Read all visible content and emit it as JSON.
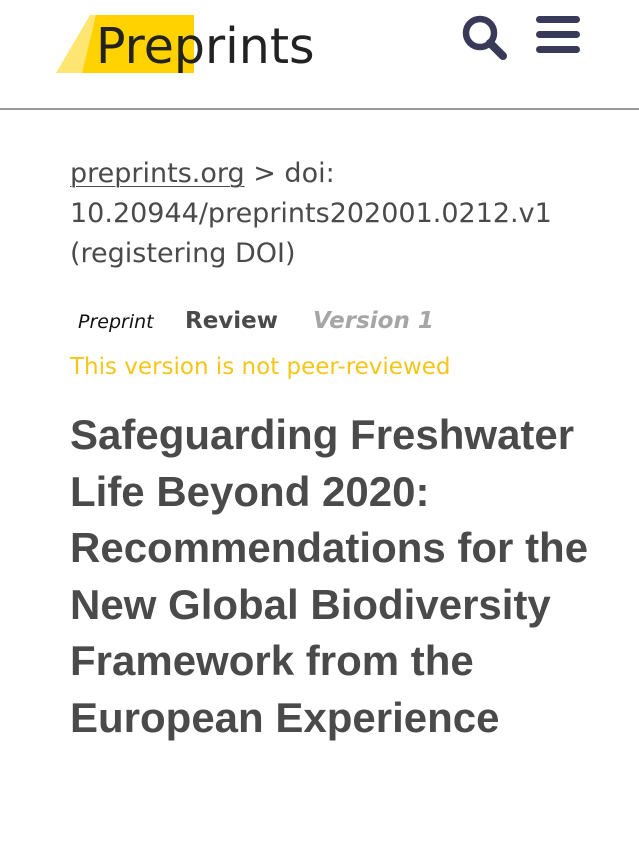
{
  "header": {
    "logo_text_prefix": "Pre",
    "logo_text_suffix": "prints",
    "brand_color": "#FFD200",
    "search_icon": "search-icon",
    "menu_icon": "hamburger-menu-icon"
  },
  "breadcrumb": {
    "site_link": "preprints.org",
    "separator": " > doi:",
    "doi": "10.20944/preprints202001.0212.v1",
    "status": "(registering DOI)"
  },
  "tabs": {
    "preprint": "Preprint",
    "review": "Review",
    "version": "Version 1"
  },
  "notice": {
    "text": "This version is not peer-reviewed",
    "color": "#F5C518"
  },
  "article": {
    "title": "Safeguarding Freshwater Life Beyond 2020: Recommendations for the New Global Biodiversity Framework from the European Experience"
  }
}
